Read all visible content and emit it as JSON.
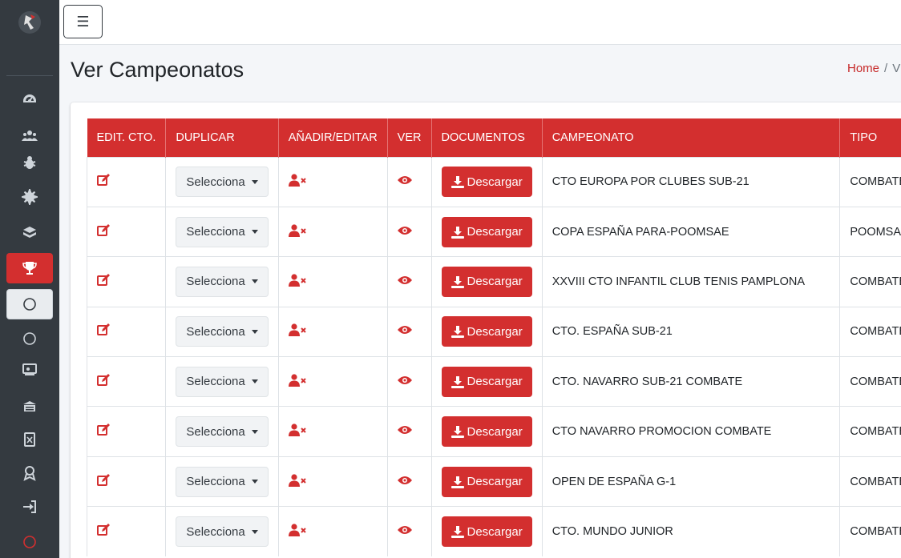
{
  "navbar": {
    "menu_icon": "☰"
  },
  "sidebar": {
    "items": [
      {
        "icon": "dashboard-icon"
      },
      {
        "icon": "users-icon"
      },
      {
        "icon": "bug-icon"
      },
      {
        "icon": "settings-icon"
      },
      {
        "icon": "layers-icon"
      },
      {
        "icon": "trophy-icon",
        "active": true
      },
      {
        "icon": "circle-icon",
        "highlight": true
      },
      {
        "icon": "circle-icon"
      },
      {
        "icon": "monitor-user-icon"
      },
      {
        "icon": "building-icon"
      },
      {
        "icon": "excel-file-icon"
      },
      {
        "icon": "award-icon"
      },
      {
        "icon": "sign-in-icon"
      },
      {
        "icon": "circle-icon-red"
      }
    ]
  },
  "header": {
    "title": "Ver Campeonatos",
    "breadcrumb": {
      "home": "Home",
      "separator": "/",
      "current": "V"
    }
  },
  "table": {
    "columns": [
      "EDIT. CTO.",
      "DUPLICAR",
      "AÑADIR/EDITAR",
      "VER",
      "DOCUMENTOS",
      "CAMPEONATO",
      "TIPO"
    ],
    "select_label": "Selecciona",
    "download_label": "Descargar",
    "rows": [
      {
        "campeonato": "CTO EUROPA POR CLUBES SUB-21",
        "tipo": "COMBATE"
      },
      {
        "campeonato": "COPA ESPAÑA PARA-POOMSAE",
        "tipo": "POOMSAE"
      },
      {
        "campeonato": "XXVIII CTO INFANTIL CLUB TENIS PAMPLONA",
        "tipo": "COMBATE"
      },
      {
        "campeonato": "CTO. ESPAÑA SUB-21",
        "tipo": "COMBATE"
      },
      {
        "campeonato": "CTO. NAVARRO SUB-21 COMBATE",
        "tipo": "COMBATE"
      },
      {
        "campeonato": "CTO NAVARRO PROMOCION COMBATE",
        "tipo": "COMBATE"
      },
      {
        "campeonato": "OPEN DE ESPAÑA G-1",
        "tipo": "COMBATE"
      },
      {
        "campeonato": "CTO. MUNDO JUNIOR",
        "tipo": "COMBATE"
      }
    ]
  },
  "colors": {
    "accent": "#d32f2f",
    "sidebar": "#343a40"
  }
}
